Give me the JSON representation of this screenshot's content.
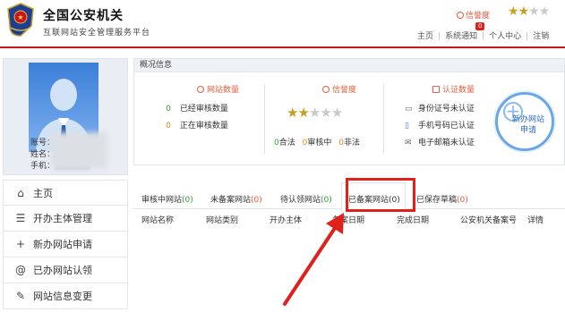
{
  "header": {
    "title": "全国公安机关",
    "subtitle": "互联网站安全管理服务平台",
    "credit_label": "信誉度",
    "credit_stars": 2,
    "badge_count": "0",
    "nav": [
      "主页",
      "系统通知",
      "个人中心",
      "注销"
    ]
  },
  "profile": {
    "account_label": "账号：",
    "name_label": "姓名：",
    "phone_label": "手机："
  },
  "menu": [
    {
      "label": "主页",
      "icon": "home-icon"
    },
    {
      "label": "开办主体管理",
      "icon": "list-icon"
    },
    {
      "label": "新办网站申请",
      "icon": "plus-icon"
    },
    {
      "label": "已办网站认领",
      "icon": "at-icon"
    },
    {
      "label": "网站信息变更",
      "icon": "edit-icon"
    }
  ],
  "overview": {
    "title": "概况信息",
    "website_count": {
      "heading": "网站数量",
      "audited_num": "0",
      "audited_label": "已经审核数量",
      "auditing_num": "0",
      "auditing_label": "正在审核数量"
    },
    "credit": {
      "heading": "信誉度",
      "stars": 2,
      "qualified": "0",
      "qualified_label": "合法",
      "auditing": "0",
      "auditing_label": "审核中",
      "illegal": "0",
      "illegal_label": "非法"
    },
    "certification": {
      "heading": "认证数量",
      "items": [
        "身份证号未认证",
        "手机号码已认证",
        "电子邮箱未认证"
      ]
    },
    "new_site_button": "新办网站申请"
  },
  "tabs": [
    {
      "label": "审核中网站",
      "count": "(0)"
    },
    {
      "label": "未备案网站",
      "count": "(0)"
    },
    {
      "label": "待认领网站",
      "count": "(0)"
    },
    {
      "label": "已备案网站",
      "count": "(0)"
    },
    {
      "label": "已保存草稿",
      "count": "(0)"
    }
  ],
  "table_columns": [
    "网站名称",
    "网站类别",
    "开办主体",
    "备案日期",
    "完成日期",
    "公安机关备案号",
    "详情"
  ],
  "colors": {
    "brand_red": "#c9151e",
    "highlight_red": "#e0201b",
    "accent_orange": "#e0573a",
    "count_green": "#2e9e3b"
  }
}
